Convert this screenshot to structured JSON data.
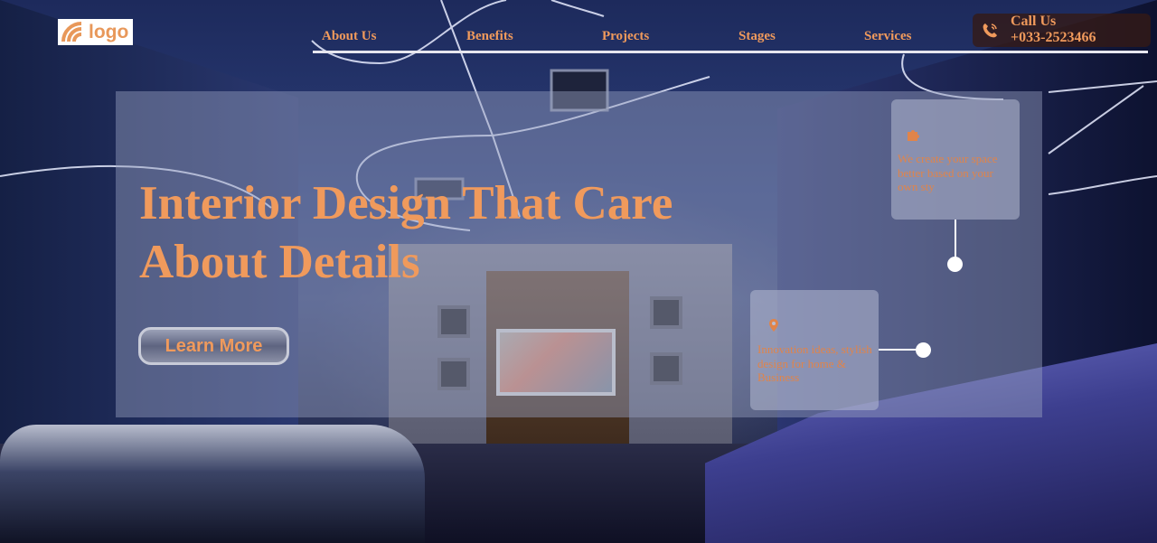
{
  "header": {
    "logo_text": "logo",
    "nav": [
      {
        "label": "About Us"
      },
      {
        "label": "Benefits"
      },
      {
        "label": "Projects"
      },
      {
        "label": "Stages"
      },
      {
        "label": "Services"
      }
    ],
    "call": {
      "title": "Call Us",
      "phone": "+033-2523466",
      "icon": "phone-ringing-icon"
    }
  },
  "hero": {
    "title": "Interior Design That Care About Details",
    "cta_label": "Learn More"
  },
  "features": [
    {
      "icon": "puzzle-icon",
      "text": "We create your space better based on your own sty"
    },
    {
      "icon": "location-pin-icon",
      "text": "Innovation ideas, stylish design for home & Business"
    }
  ],
  "colors": {
    "accent": "#f09a5c",
    "overlay": "#96a0be",
    "call_bg": "#341a14",
    "nav_line": "#e6e6ee"
  }
}
